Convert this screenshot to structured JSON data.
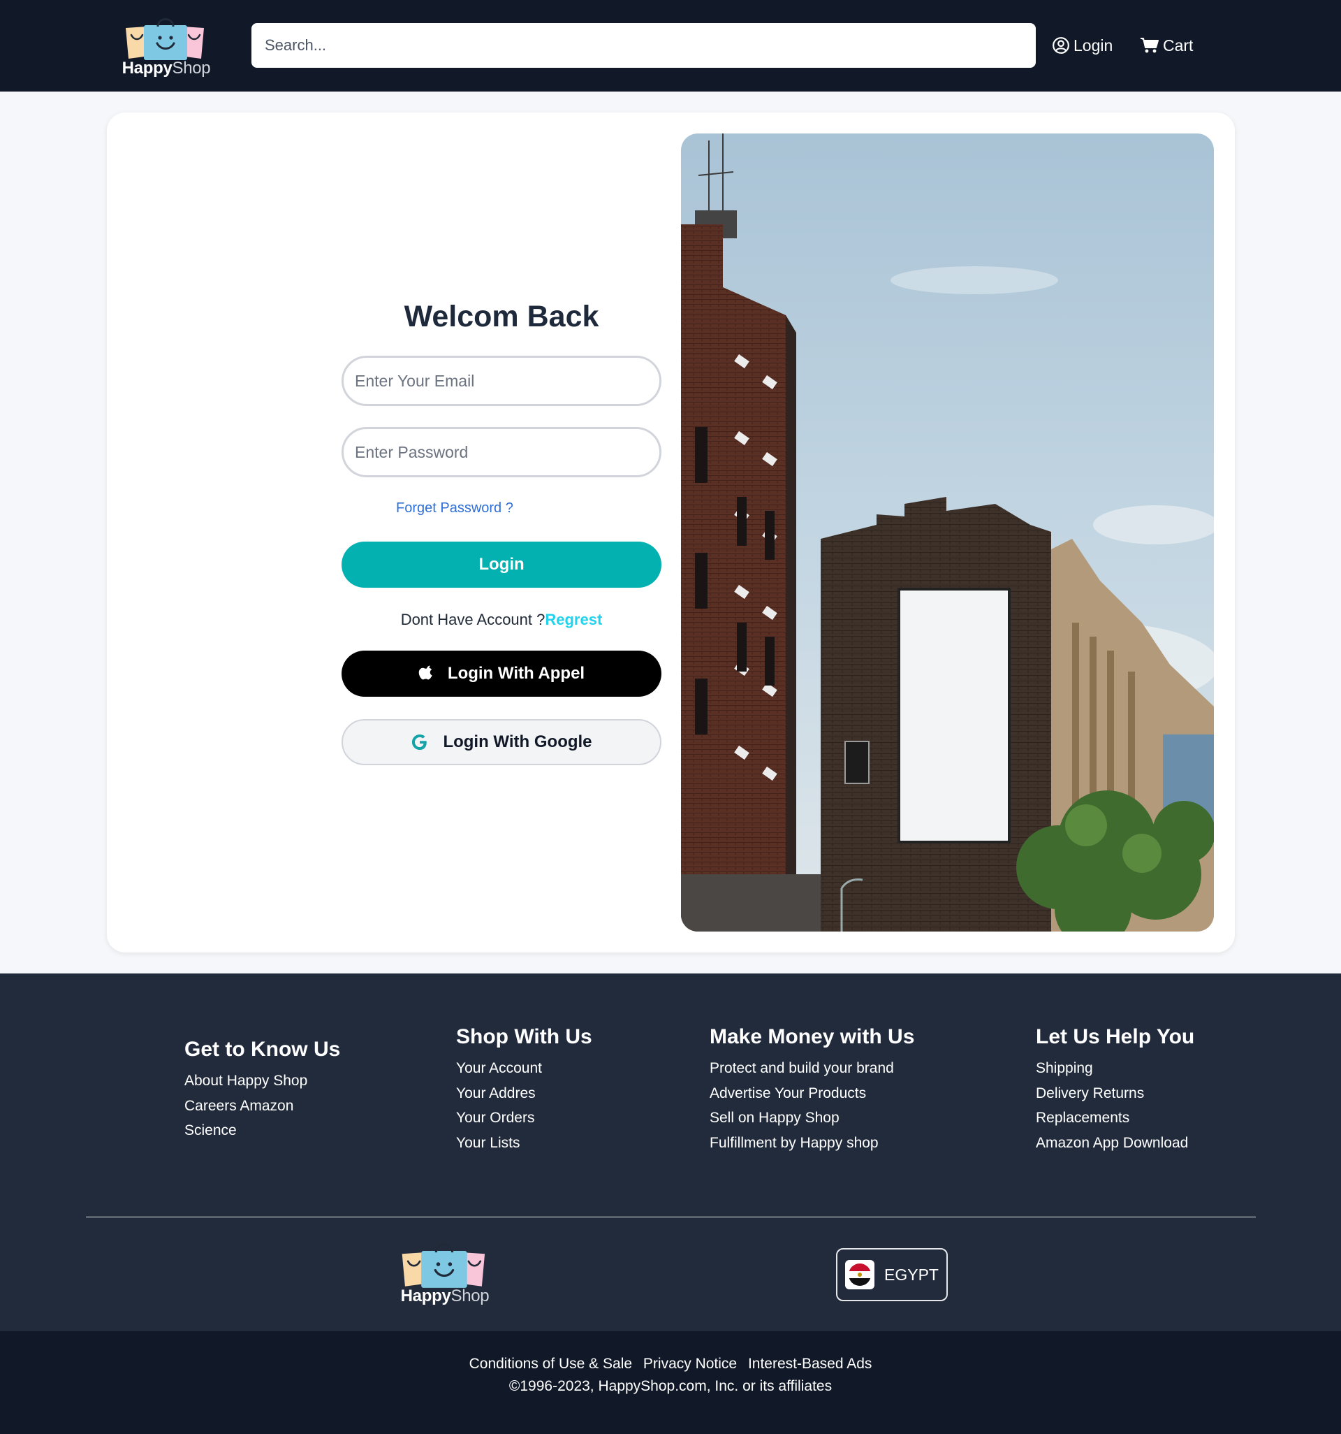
{
  "header": {
    "logo": {
      "word1": "Happy",
      "word2": "Shop"
    },
    "search_placeholder": "Search...",
    "login_label": "Login",
    "cart_label": "Cart"
  },
  "login_form": {
    "title": "Welcom Back",
    "email_placeholder": "Enter Your Email",
    "password_placeholder": "Enter Password",
    "forget_password": "Forget Password ?",
    "login_button": "Login",
    "no_account_text": "Dont Have Account ?",
    "register_link": "Regrest",
    "apple_button": "Login With Appel",
    "google_button": "Login With Google"
  },
  "footer": {
    "columns": [
      {
        "title": "Get to Know Us",
        "links": [
          "About Happy Shop",
          "Careers Amazon",
          "Science"
        ]
      },
      {
        "title": "Shop With Us",
        "links": [
          "Your Account",
          "Your Addres",
          "Your Orders",
          "Your Lists"
        ]
      },
      {
        "title": "Make Money with Us",
        "links": [
          "Protect and build your brand",
          "Advertise Your Products",
          "Sell on Happy Shop",
          "Fulfillment by Happy shop"
        ]
      },
      {
        "title": "Let Us Help You",
        "links": [
          "Shipping",
          "Delivery Returns",
          "Replacements",
          "Amazon App Download"
        ]
      }
    ],
    "logo": {
      "word1": "Happy",
      "word2": "Shop"
    },
    "country": "EGYPT"
  },
  "bottom_bar": {
    "links": [
      "Conditions of Use & Sale",
      "Privacy Notice",
      "Interest-Based Ads"
    ],
    "copyright": "©1996-2023, HappyShop.com, Inc. or its affiliates"
  },
  "colors": {
    "header_bg": "#111827",
    "footer_bg": "#222b3c",
    "accent_teal": "#04b1b1",
    "link_blue": "#2f6fd6",
    "register_cyan": "#22d3ee"
  },
  "icons": [
    "user-circle-icon",
    "cart-icon",
    "apple-icon",
    "google-icon",
    "egypt-flag-icon"
  ]
}
